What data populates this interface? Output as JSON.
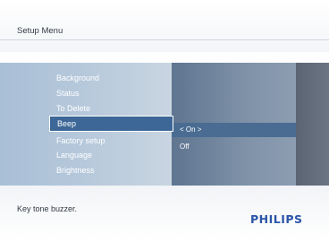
{
  "header": {
    "title": "Setup Menu"
  },
  "menu": {
    "items": [
      {
        "label": "Background"
      },
      {
        "label": "Status"
      },
      {
        "label": "To Delete"
      },
      {
        "label": "Beep"
      },
      {
        "label": "Factory setup"
      },
      {
        "label": "Language"
      },
      {
        "label": "Brightness"
      }
    ],
    "selected_label": "Beep"
  },
  "options": {
    "items": [
      {
        "label": "< On >"
      },
      {
        "label": "Off"
      }
    ],
    "selected_label": "< On >"
  },
  "footer": {
    "help_text": "Key tone buzzer.",
    "brand": "PHILIPS"
  },
  "colors": {
    "brand": "#2a55a8",
    "selection": "#3d6796"
  }
}
